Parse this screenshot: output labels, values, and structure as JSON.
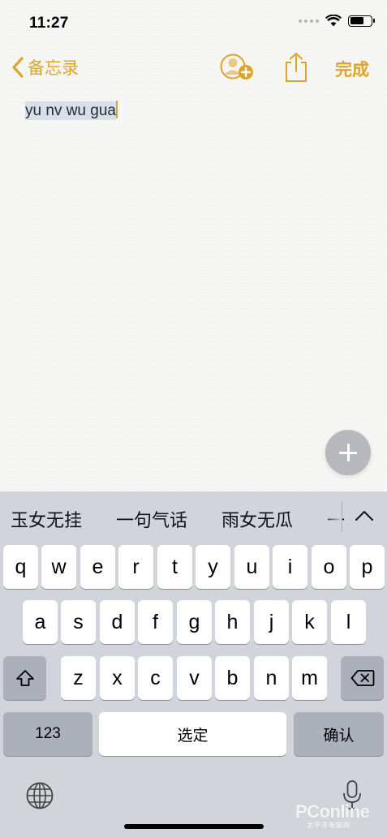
{
  "status_bar": {
    "time": "11:27"
  },
  "nav": {
    "back_label": "备忘录",
    "done_label": "完成"
  },
  "note": {
    "composing_text": "yu nv wu gua"
  },
  "colors": {
    "accent": "#dea32a",
    "keyboard_bg": "#d2d4db",
    "special_key": "#abb0ba",
    "marked_text_bg": "#d6dfea"
  },
  "keyboard": {
    "candidates": [
      "玉女无挂",
      "一句气话",
      "雨女无瓜",
      "一"
    ],
    "row1": [
      "q",
      "w",
      "e",
      "r",
      "t",
      "y",
      "u",
      "i",
      "o",
      "p"
    ],
    "row2": [
      "a",
      "s",
      "d",
      "f",
      "g",
      "h",
      "j",
      "k",
      "l"
    ],
    "row3": [
      "z",
      "x",
      "c",
      "v",
      "b",
      "n",
      "m"
    ],
    "numbers_label": "123",
    "space_label": "选定",
    "return_label": "确认",
    "icons": [
      "shift-icon",
      "delete-icon",
      "globe-icon",
      "microphone-icon",
      "chevron-up-icon",
      "add-person-icon",
      "share-icon",
      "plus-icon"
    ]
  },
  "watermark": {
    "logo": "PConline",
    "sub": "太平洋电脑网"
  }
}
